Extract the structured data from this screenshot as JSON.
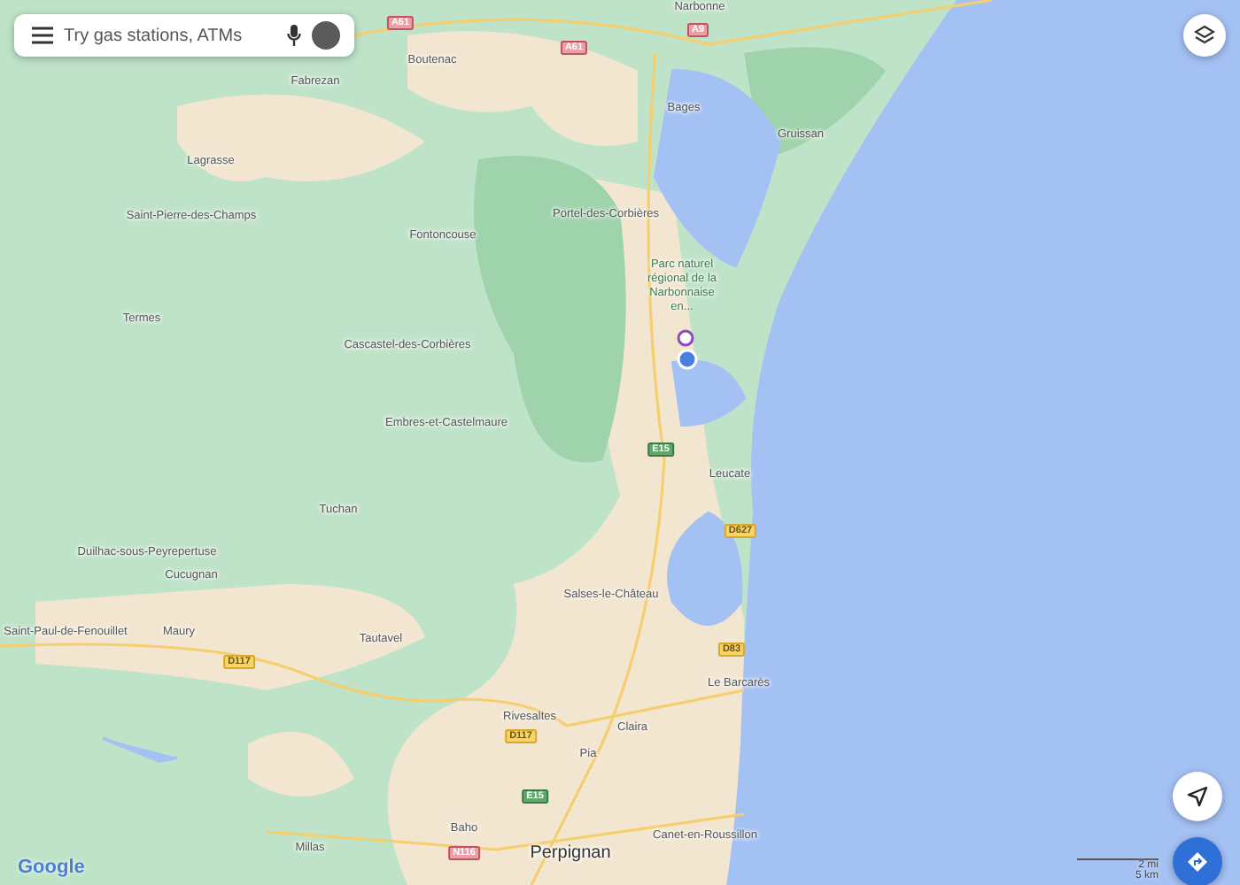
{
  "search": {
    "placeholder": "Try gas stations, ATMs"
  },
  "map": {
    "places": [
      {
        "name": "Narbonne",
        "kind": "town"
      },
      {
        "name": "Boutenac",
        "kind": "town"
      },
      {
        "name": "Fabrezan",
        "kind": "town"
      },
      {
        "name": "Bages",
        "kind": "town"
      },
      {
        "name": "Gruissan",
        "kind": "town"
      },
      {
        "name": "Lagrasse",
        "kind": "town"
      },
      {
        "name": "Saint-Pierre-des-Champs",
        "kind": "town"
      },
      {
        "name": "Portel-des-Corbières",
        "kind": "town"
      },
      {
        "name": "Fontoncouse",
        "kind": "town"
      },
      {
        "name": "Parc naturel régional de la Narbonnaise en...",
        "kind": "park"
      },
      {
        "name": "Termes",
        "kind": "town"
      },
      {
        "name": "Cascastel-des-Corbières",
        "kind": "town"
      },
      {
        "name": "Embres-et-Castelmaure",
        "kind": "town"
      },
      {
        "name": "Leucate",
        "kind": "town"
      },
      {
        "name": "Tuchan",
        "kind": "town"
      },
      {
        "name": "Duilhac-sous-Peyrepertuse",
        "kind": "town"
      },
      {
        "name": "Cucugnan",
        "kind": "town"
      },
      {
        "name": "Salses-le-Château",
        "kind": "town"
      },
      {
        "name": "Saint-Paul-de-Fenouillet",
        "kind": "town"
      },
      {
        "name": "Maury",
        "kind": "town"
      },
      {
        "name": "Tautavel",
        "kind": "town"
      },
      {
        "name": "Le Barcarès",
        "kind": "town"
      },
      {
        "name": "Rivesaltes",
        "kind": "town"
      },
      {
        "name": "Claira",
        "kind": "town"
      },
      {
        "name": "Pia",
        "kind": "town"
      },
      {
        "name": "Canet-en-Roussillon",
        "kind": "town"
      },
      {
        "name": "Baho",
        "kind": "town"
      },
      {
        "name": "Millas",
        "kind": "town"
      },
      {
        "name": "Perpignan",
        "kind": "city"
      }
    ],
    "road_shields": [
      {
        "label": "A61",
        "kind": "motorway"
      },
      {
        "label": "A61",
        "kind": "motorway"
      },
      {
        "label": "A9",
        "kind": "motorway"
      },
      {
        "label": "E15",
        "kind": "european"
      },
      {
        "label": "D627",
        "kind": "departmental"
      },
      {
        "label": "D83",
        "kind": "departmental"
      },
      {
        "label": "D117",
        "kind": "departmental"
      },
      {
        "label": "D117",
        "kind": "departmental"
      },
      {
        "label": "E15",
        "kind": "european"
      },
      {
        "label": "N116",
        "kind": "motorway"
      }
    ],
    "scale": {
      "miles": "2 mi",
      "km": "5 km"
    },
    "logo": "Google"
  }
}
